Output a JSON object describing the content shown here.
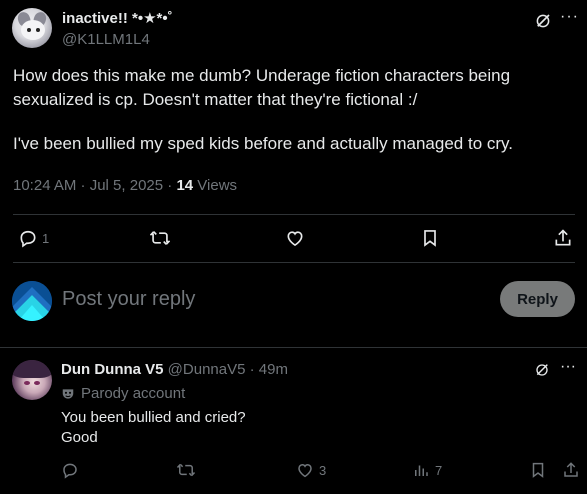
{
  "main_post": {
    "author_name": "inactive!! *•★*•˚",
    "handle": "@K1LLM1L4",
    "body_line1": "How does this make me dumb? Underage fiction characters being",
    "body_line2": "sexualized is cp. Doesn't matter that they're fictional :/",
    "body_line3": "I've been bullied my sped kids before and actually managed to cry.",
    "timestamp": "10:24 AM · Jul 5, 2025 · ",
    "views_count": "14",
    "views_label": " Views",
    "reply_count": "1",
    "more_glyph": "···"
  },
  "composer": {
    "placeholder": "Post your reply",
    "button_label": "Reply"
  },
  "reply_post": {
    "author_name": "Dun Dunna V5",
    "handle": " @DunnaV5 · 49m",
    "parody_label": "Parody account",
    "text_line1": "You been bullied and cried?",
    "text_line2": "Good",
    "like_count": "3",
    "views_count": "7",
    "more_glyph": "···"
  },
  "icons": {
    "reply": "reply-icon",
    "repost": "repost-icon",
    "like": "heart-icon",
    "bookmark": "bookmark-icon",
    "share": "share-icon",
    "grok": "grok-icon",
    "views": "views-icon"
  },
  "colors": {
    "background": "#000000",
    "text_primary": "#e7e9ea",
    "text_secondary": "#71767b",
    "divider": "#2f3336",
    "reply_button_bg": "#787a7a"
  }
}
